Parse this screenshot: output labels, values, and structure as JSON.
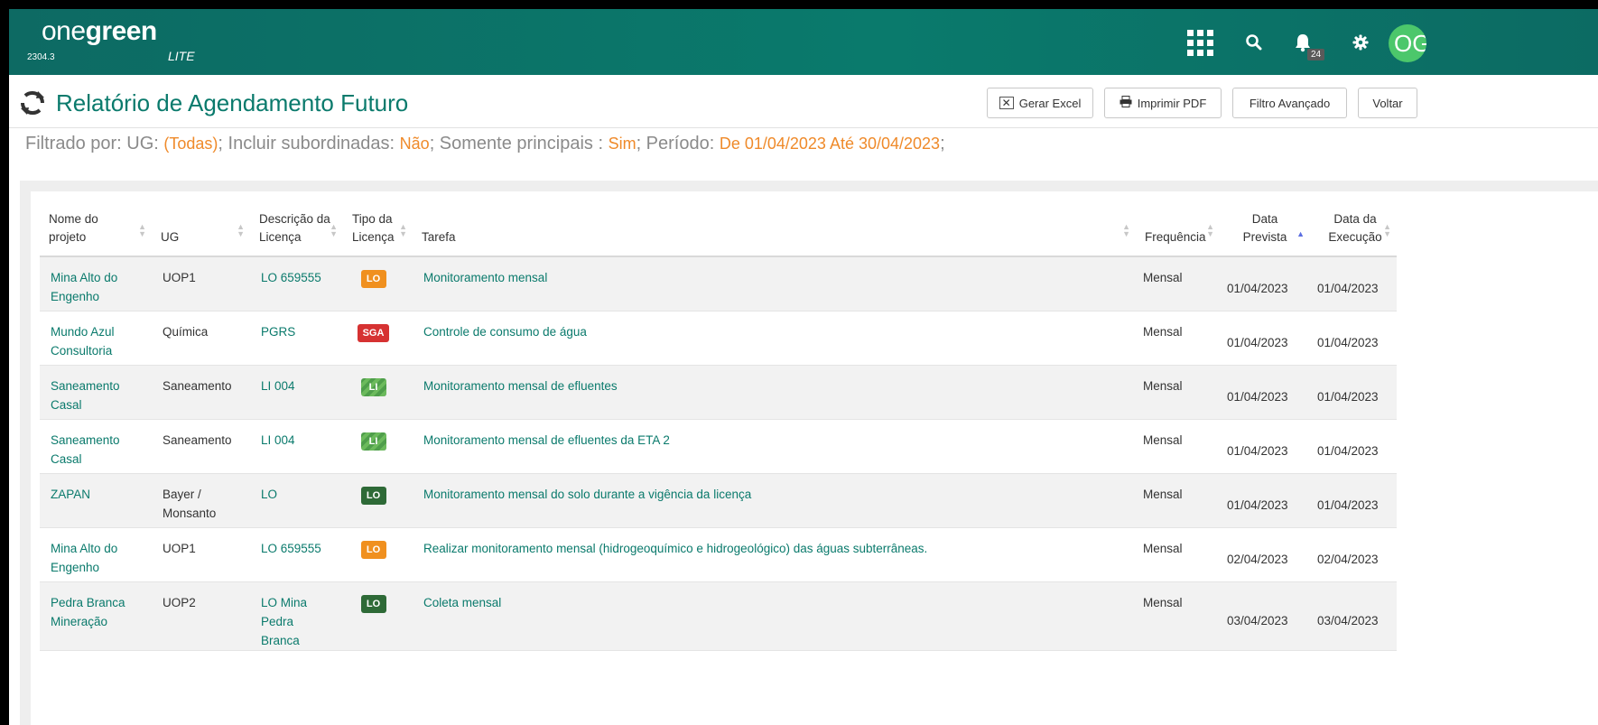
{
  "header": {
    "logo_one": "one",
    "logo_green": "green",
    "logo_lite": "LITE",
    "version": "2304.3",
    "notifications_count": "24",
    "avatar_initials": "OG",
    "icons": [
      "apps-grid-icon",
      "search-icon",
      "bell-icon",
      "gear-icon"
    ]
  },
  "page": {
    "title": "Relatório de Agendamento Futuro"
  },
  "toolbar": {
    "excel_label": "Gerar Excel",
    "pdf_label": "Imprimir PDF",
    "filter_label": "Filtro Avançado",
    "back_label": "Voltar"
  },
  "filter": {
    "prefix": "Filtrado por:",
    "ug_label": " UG: ",
    "ug_value": "(Todas)",
    "sub_label": "; Incluir subordinadas: ",
    "sub_value": "Não",
    "main_label": "; Somente principais : ",
    "main_value": "Sim",
    "period_label": "; Período: ",
    "period_value": "De 01/04/2023 Até 30/04/2023",
    "end": ";"
  },
  "table": {
    "columns": [
      "Nome do projeto",
      "UG",
      "Descrição da Licença",
      "Tipo da Licença",
      "Tarefa",
      "Frequência",
      "Data Prevista",
      "Data da Execução"
    ],
    "rows": [
      {
        "projeto": "Mina Alto do Engenho",
        "ug": "UOP1",
        "licenca": "LO 659555",
        "tipo": "LO",
        "tarefa": "Monitoramento mensal",
        "frequencia": "Mensal",
        "prevista": "01/04/2023",
        "execucao": "01/04/2023"
      },
      {
        "projeto": "Mundo Azul Consultoria",
        "ug": "Química",
        "licenca": "PGRS",
        "tipo": "SGA",
        "tarefa": "Controle de consumo de água",
        "frequencia": "Mensal",
        "prevista": "01/04/2023",
        "execucao": "01/04/2023"
      },
      {
        "projeto": "Saneamento Casal",
        "ug": "Saneamento",
        "licenca": "LI 004",
        "tipo": "LI",
        "tarefa": "Monitoramento mensal de efluentes",
        "frequencia": "Mensal",
        "prevista": "01/04/2023",
        "execucao": "01/04/2023"
      },
      {
        "projeto": "Saneamento Casal",
        "ug": "Saneamento",
        "licenca": "LI 004",
        "tipo": "LI",
        "tarefa": "Monitoramento mensal de efluentes da ETA 2",
        "frequencia": "Mensal",
        "prevista": "01/04/2023",
        "execucao": "01/04/2023"
      },
      {
        "projeto": "ZAPAN",
        "ug": "Bayer / Monsanto",
        "licenca": "LO",
        "tipo": "LO",
        "tarefa": "Monitoramento mensal do solo durante a vigência da licença",
        "frequencia": "Mensal",
        "prevista": "01/04/2023",
        "execucao": "01/04/2023"
      },
      {
        "projeto": "Mina Alto do Engenho",
        "ug": "UOP1",
        "licenca": "LO 659555",
        "tipo": "LO",
        "tarefa": "Realizar monitoramento mensal (hidrogeoquímico e hidrogeológico) das águas subterrâneas.",
        "frequencia": "Mensal",
        "prevista": "02/04/2023",
        "execucao": "02/04/2023"
      },
      {
        "projeto": "Pedra Branca Mineração",
        "ug": "UOP2",
        "licenca": "LO Mina Pedra Branca",
        "tipo": "LO",
        "tarefa": "Coleta mensal",
        "frequencia": "Mensal",
        "prevista": "03/04/2023",
        "execucao": "03/04/2023"
      }
    ]
  },
  "colors": {
    "brand_green": "#0a7a6c",
    "filter_value": "#ef8a2a",
    "badge_lo_orange": "#f0901f",
    "badge_sga_red": "#d63232",
    "badge_lo_green": "#2e6a37",
    "badge_li": "#4f9e4b"
  }
}
